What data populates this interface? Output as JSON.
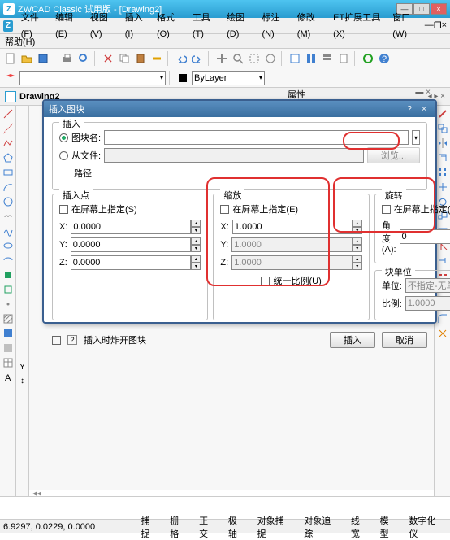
{
  "app": {
    "title": "ZWCAD Classic 试用版 - [Drawing2]"
  },
  "menu": {
    "items": [
      "文件(F)",
      "编辑(E)",
      "视图(V)",
      "插入(I)",
      "格式(O)",
      "工具(T)",
      "绘图(D)",
      "标注(N)",
      "修改(M)",
      "ET扩展工具(X)",
      "窗口(W)"
    ],
    "help": "帮助(H)"
  },
  "toolbar": {
    "layer_dropdown": "ByLayer"
  },
  "doc": {
    "tab": "Drawing2"
  },
  "props": {
    "title": "属性"
  },
  "dialog": {
    "title": "插入图块",
    "insert_legend": "插入",
    "blockname_label": "图块名:",
    "fromfile_label": "从文件:",
    "browse": "浏览...",
    "path_label": "路径:",
    "ip": {
      "legend": "插入点",
      "onscreen": "在屏幕上指定(S)",
      "x": "X:",
      "y": "Y:",
      "z": "Z:",
      "xv": "0.0000",
      "yv": "0.0000",
      "zv": "0.0000"
    },
    "scale": {
      "legend": "缩放",
      "onscreen": "在屏幕上指定(E)",
      "x": "X:",
      "y": "Y:",
      "z": "Z:",
      "xv": "1.0000",
      "yv": "1.0000",
      "zv": "1.0000",
      "uniform": "统一比例(U)"
    },
    "rot": {
      "legend": "旋转",
      "onscreen": "在屏幕上指定(C)",
      "angle_label": "角度(A):",
      "angle": "0"
    },
    "blkunit": {
      "legend": "块单位",
      "unit_label": "单位:",
      "unit": "不指定-无单位",
      "ratio_label": "比例:",
      "ratio": "1.0000"
    },
    "explode": "插入时炸开图块",
    "ok": "插入",
    "cancel": "取消"
  },
  "status": {
    "coord": "6.9297, 0.0229, 0.0000",
    "buttons": [
      "捕捉",
      "栅格",
      "正交",
      "极轴",
      "对象捕捉",
      "对象追踪",
      "线宽",
      "模型",
      "数字化仪"
    ]
  }
}
